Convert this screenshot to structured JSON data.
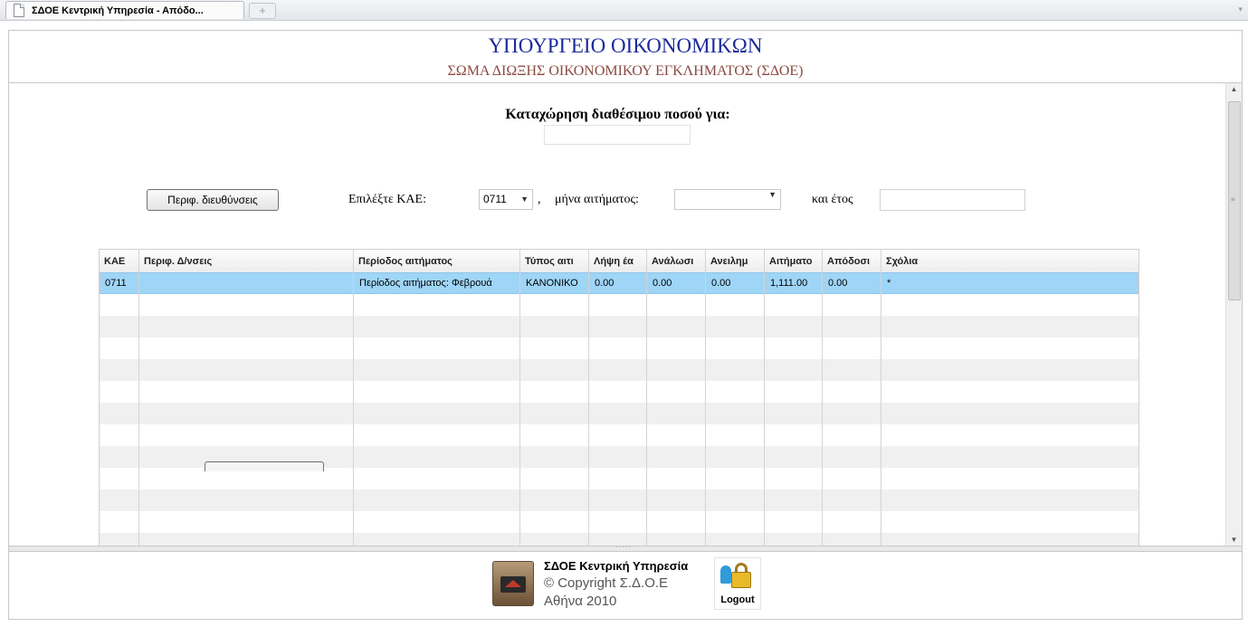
{
  "browser": {
    "tab_title": "ΣΔΟΕ  Κεντρική  Υπηρεσία - Απόδο...",
    "new_tab": "+"
  },
  "header": {
    "ministry": "ΥΠΟΥΡΓΕΙΟ ΟΙΚΟΝΟΜΙΚΩΝ",
    "agency": "ΣΩΜΑ ΔΙΩΞΗΣ ΟΙΚΟΝΟΜΙΚΟΥ ΕΓΚΛΗΜΑΤΟΣ (ΣΔΟΕ)"
  },
  "form": {
    "entry_title": "Καταχώρηση  διαθέσιμου  ποσού  για:",
    "addresses_button": "Περιφ. διευθύνσεις",
    "select_kae_label": "Επιλέξτε  ΚΑΕ:",
    "kae_value": "0711",
    "comma": ",",
    "month_label": "μήνα αιτήματος:",
    "month_value": "",
    "year_label": "και έτος",
    "year_value": ""
  },
  "grid": {
    "columns": [
      "ΚΑΕ",
      "Περιφ. Δ/νσεις",
      "Περίοδος αιτήματος",
      "Τύπος αιτι",
      "Λήψη έα",
      "Ανάλωσι",
      "Ανειλημ",
      "Αιτήματο",
      "Απόδοσι",
      "Σχόλια"
    ],
    "rows": [
      [
        "0711",
        "",
        "Περίοδος αιτήματος: Φεβρουά",
        "ΚΑΝΟΝΙΚΟ",
        "0.00",
        "0.00",
        "0.00",
        "1,111.00",
        "0.00",
        "*"
      ]
    ]
  },
  "footer": {
    "org": "ΣΔΟΕ  Κεντρική  Υπηρεσία",
    "copyright": "© Copyright Σ.Δ.Ο.Ε",
    "city_year": "Αθήνα 2010",
    "logout": "Logout"
  },
  "colors": {
    "ministry": "#1c2a9a",
    "agency": "#8a4a40",
    "selected_row": "#9fd5f7"
  }
}
